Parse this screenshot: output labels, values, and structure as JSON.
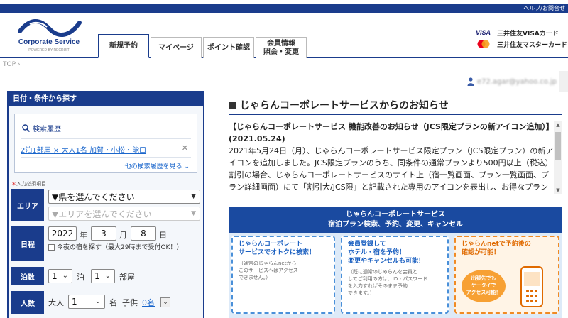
{
  "header": {
    "help_link": "ヘルプ/お問合せ",
    "logo_name": "Corporate Service",
    "logo_by": "POWERED BY RECRUIT",
    "tabs": [
      {
        "label": "新規予約"
      },
      {
        "label": "マイページ"
      },
      {
        "label": "ポイント確認"
      },
      {
        "label": "会員情報\n照会・変更"
      }
    ],
    "cards": [
      {
        "brand": "VISA",
        "label": "三井住友VISAカード"
      },
      {
        "brand": "mastercard",
        "label": "三井住友マスターカード"
      }
    ]
  },
  "breadcrumb": "TOP",
  "user_email": "e72.agar@yahoo.co.jp",
  "search": {
    "title": "日付・条件から探す",
    "history_label": "検索履歴",
    "history_item": "2泊1部屋 × 大人1名 加賀・小松・能口",
    "history_more": "他の検索履歴を見る",
    "required_label": "入力必須項目",
    "area_label": "エリア",
    "prefecture_value": "▼県を選んでください",
    "area_value": "▼エリアを選んでください",
    "date_label": "日程",
    "year": "2022",
    "year_unit": "年",
    "month": "3",
    "month_unit": "月",
    "day": "8",
    "day_unit": "日",
    "tonight_label": "今夜の宿を探す（最大29時まで受付OK！）",
    "nights_label": "泊数",
    "nights": "1",
    "nights_unit": "泊",
    "rooms": "1",
    "rooms_unit": "部屋",
    "people_label": "人数",
    "adult_label": "大人",
    "adults": "1",
    "adult_unit": "名",
    "child_label": "子供",
    "children": "0名"
  },
  "notice": {
    "title": "じゃらんコーポレートサービスからのお知らせ",
    "headline": "【じゃらんコーポレートサービス 機能改善のお知らせ（JCS限定プランの新アイコン追加）】(2021.05.24)",
    "body": "2021年5月24日（月）、じゃらんコーポレートサービス限定プラン（JCS限定プラン）の新アイコンを追加しました。JCS限定プランのうち、同条件の通常プランより500円以上（税込）割引の場合、じゃらんコーポレートサービスのサイト上（宿一覧画面、プラン一覧画面、プラン詳細画面）にて「割引大/JCS限」と記載された専用のアイコンを表出し、お得なプランであることをお知らせします。"
  },
  "banner": {
    "line1": "じゃらんコーポレートサービス",
    "line2": "宿泊プラン検索、予約、変更、キャンセル",
    "boxes": [
      {
        "title": "じゃらんコーポレート\nサービスでオトクに検索！",
        "sub": "（通常のじゃらんnetから\nこのサービスへはアクセス\nできません。）"
      },
      {
        "title": "会員登録して\nホテル・宿を予約！\n変更やキャンセルも可能！",
        "sub": "（既に通常のじゃらんを会員と\nしてご利用の方は、ID・パスワード\nを入力すればそのまま予約\nできます。）"
      },
      {
        "title": "じゃらんnetで予約後の\n確認が可能！",
        "sub": "出張先でも\nケータイで\nアクセス可能！"
      }
    ]
  }
}
